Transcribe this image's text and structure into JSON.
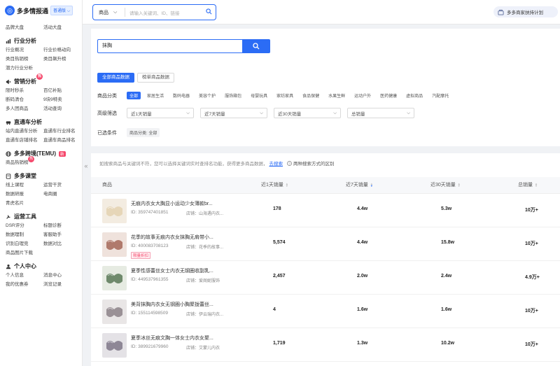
{
  "app": {
    "name": "多多情报通",
    "version_badge": "普通版"
  },
  "sidebar": {
    "top_items": [
      "品牌大盘",
      "活动大盘"
    ],
    "sections": [
      {
        "title": "行业分析",
        "icon": "chart-icon",
        "items": [
          "行业概况",
          "行业价格动向",
          "类目热销榜",
          "类目飙升榜",
          "潜力行业分析"
        ]
      },
      {
        "title": "营销分析",
        "icon": "megaphone-icon",
        "hot": "热",
        "items": [
          "限时秒杀",
          "百亿补贴",
          "断码清仓",
          "9块9特卖",
          "多人团商品",
          "活动查询"
        ]
      },
      {
        "title": "直通车分析",
        "icon": "car-icon",
        "items": [
          "站内直通车分析",
          "直通车行业排名",
          "直通车店铺排名",
          "直通车商品排名"
        ]
      },
      {
        "title": "多多跨境(TEMU)",
        "icon": "globe-icon",
        "tag": "新",
        "items": [
          "商品热销榜"
        ],
        "item_hot": "热"
      },
      {
        "title": "多多课堂",
        "icon": "book-icon",
        "items": [
          "线上课程",
          "运营干货",
          "数据研报",
          "电商圈",
          "青虎名片"
        ]
      },
      {
        "title": "运营工具",
        "icon": "tool-icon",
        "items": [
          "DSR评分",
          "标题诊断",
          "数据理制",
          "客服助手",
          "识别白理竞",
          "数据对比",
          "商品图片下载"
        ]
      },
      {
        "title": "个人中心",
        "icon": "user-icon",
        "items": [
          "个人信息",
          "消息中心",
          "我的优惠券",
          "浏览记录"
        ]
      }
    ]
  },
  "topbar": {
    "search_category": "商品",
    "search_placeholder": "请输入关键词、ID、链接",
    "merchant_label": "多多商家扶持计划"
  },
  "search": {
    "value": "抹胸",
    "button_icon": "search-icon"
  },
  "data_tabs": [
    {
      "label": "全部商品数据",
      "active": true
    },
    {
      "label": "榜单商品数据",
      "active": false
    }
  ],
  "filters": {
    "category_label": "商品分类",
    "categories": [
      {
        "label": "全部",
        "active": true
      },
      {
        "label": "家居生活"
      },
      {
        "label": "数码电器"
      },
      {
        "label": "美容个护"
      },
      {
        "label": "服饰箱包"
      },
      {
        "label": "母婴玩具"
      },
      {
        "label": "家纺家具"
      },
      {
        "label": "食品保健"
      },
      {
        "label": "水果生鲜"
      },
      {
        "label": "运动户外"
      },
      {
        "label": "医药健康"
      },
      {
        "label": "虚拟商品"
      },
      {
        "label": "汽配摩托"
      }
    ],
    "advanced_label": "高级筛选",
    "selects": [
      "近1天销量",
      "近7天销量",
      "近30天销量",
      "总销量"
    ],
    "selected_label": "已选条件",
    "selected_chip": "商品分类: 全部"
  },
  "results": {
    "hint_text": "如搜索商品与关键词不符，您可以选择关键词实时查排名功能，获得更多商品数据，",
    "hint_link": "去搜索",
    "hint_help": "两种搜索方式的区别",
    "columns": {
      "product": "商品",
      "d1": "近1天销量",
      "d7": "近7天销量",
      "d30": "近30天销量",
      "total": "总销量"
    },
    "sorted_column": "d7",
    "rows": [
      {
        "name": "无痕内衣女大胸显小运动少女薄款br...",
        "id": "ID: 359747401851",
        "shop": "店铺：山海遇内衣...",
        "tag": "",
        "d1": "178",
        "d7": "4.4w",
        "d30": "5.3w",
        "total": "10万+",
        "colors": [
          "#f3ece1",
          "#e6d6b8"
        ]
      },
      {
        "name": "花季的故事无痕内衣女抹胸无肩带小...",
        "id": "ID: 400083708123",
        "shop": "店铺：花季的故事...",
        "tag": "限量折扣",
        "d1": "5,574",
        "d7": "4.4w",
        "d30": "15.8w",
        "total": "10万+",
        "colors": [
          "#efe2dc",
          "#b07a6c"
        ]
      },
      {
        "name": "夏季性感蕾丝女士内衣无钢圈收副乳...",
        "id": "ID: 449537961355",
        "shop": "店铺：爱阁妮服饰",
        "tag": "",
        "d1": "2,457",
        "d7": "2.0w",
        "d30": "2.4w",
        "total": "4.9万+",
        "colors": [
          "#e6ebe2",
          "#6f8a6c"
        ]
      },
      {
        "name": "美背抹胸内衣女无钢圈小胸聚拢蕾丝...",
        "id": "ID: 155114598509",
        "shop": "店铺：伊云瑞内衣...",
        "tag": "",
        "d1": "4",
        "d7": "1.6w",
        "d30": "1.6w",
        "total": "10万+",
        "colors": [
          "#e9e6e6",
          "#9a9196"
        ]
      },
      {
        "name": "夏季冰丝无痕文胸一体女士内衣女聚...",
        "id": "ID: 389921679960",
        "shop": "店铺：艾蒙儿内衣",
        "tag": "",
        "d1": "1,719",
        "d7": "1.3w",
        "d30": "10.2w",
        "total": "10万+",
        "colors": [
          "#e4e2e6",
          "#8e8796"
        ]
      }
    ]
  }
}
